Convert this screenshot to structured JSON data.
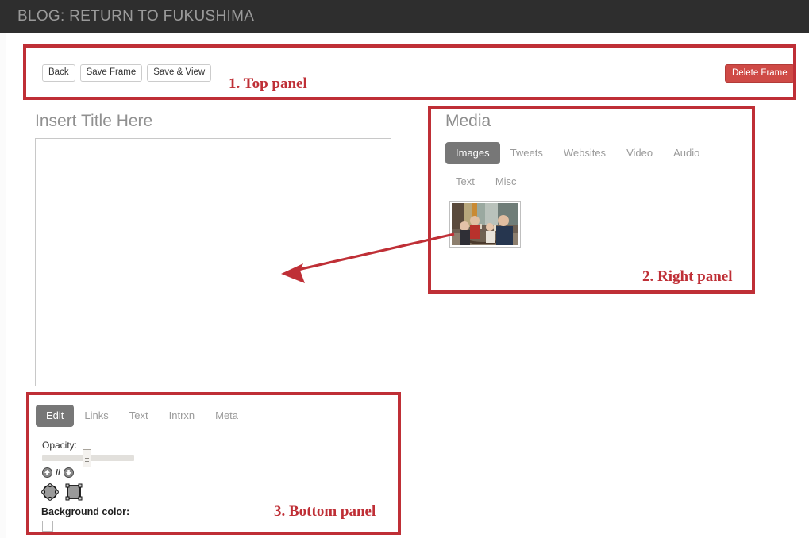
{
  "header": {
    "title": "BLOG: RETURN TO FUKUSHIMA"
  },
  "toolbar": {
    "back_label": "Back",
    "save_frame_label": "Save Frame",
    "save_view_label": "Save & View",
    "delete_frame_label": "Delete Frame"
  },
  "editor": {
    "frame_title_placeholder": "Insert Title Here"
  },
  "media": {
    "panel_title": "Media",
    "tabs_row1": [
      {
        "label": "Images",
        "active": true
      },
      {
        "label": "Tweets",
        "active": false
      },
      {
        "label": "Websites",
        "active": false
      },
      {
        "label": "Video",
        "active": false
      },
      {
        "label": "Audio",
        "active": false
      }
    ],
    "tabs_row2": [
      {
        "label": "Text",
        "active": false
      },
      {
        "label": "Misc",
        "active": false
      }
    ],
    "thumbnail_alt": "photo of four people seated around a dining table"
  },
  "bottom": {
    "tabs": [
      {
        "label": "Edit",
        "active": true
      },
      {
        "label": "Links",
        "active": false
      },
      {
        "label": "Text",
        "active": false
      },
      {
        "label": "Intrxn",
        "active": false
      },
      {
        "label": "Meta",
        "active": false
      }
    ],
    "opacity_label": "Opacity:",
    "layer_separator": "//",
    "background_color_label": "Background color:",
    "background_color_value": "#ffffff"
  },
  "annotations": {
    "accent_color": "#bf2f36",
    "labels": [
      {
        "text": "1. Top panel"
      },
      {
        "text": "2. Right panel"
      },
      {
        "text": "3. Bottom panel"
      }
    ]
  }
}
